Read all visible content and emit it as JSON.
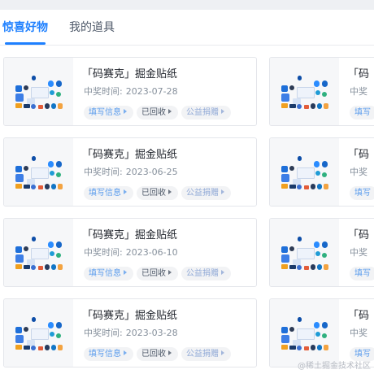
{
  "tabs": [
    {
      "label": "惊喜好物",
      "active": true
    },
    {
      "label": "我的道具",
      "active": false
    }
  ],
  "prize_cards": [
    {
      "title": "「码赛克」掘金贴纸",
      "date_label": "中奖时间:",
      "date": "2023-07-28",
      "actions": [
        "填写信息",
        "已回收",
        "公益捐赠"
      ]
    },
    {
      "title": "「码赛克」掘金贴纸",
      "date_label": "中奖时间:",
      "date": "2023-06-25",
      "actions": [
        "填写信息",
        "已回收",
        "公益捐赠"
      ]
    },
    {
      "title": "「码赛克」掘金贴纸",
      "date_label": "中奖时间:",
      "date": "2023-06-10",
      "actions": [
        "填写信息",
        "已回收",
        "公益捐赠"
      ]
    },
    {
      "title": "「码赛克」掘金贴纸",
      "date_label": "中奖时间:",
      "date": "2023-03-28",
      "actions": [
        "填写信息",
        "已回收",
        "公益捐赠"
      ]
    }
  ],
  "right_cards": [
    {
      "title": "「码",
      "date_label": "中奖",
      "action": "填写"
    },
    {
      "title": "「码",
      "date_label": "中奖",
      "action": "填写"
    },
    {
      "title": "「码",
      "date_label": "中奖",
      "action": "填写"
    },
    {
      "title": "「码",
      "date_label": "中奖",
      "action": "填写"
    }
  ],
  "watermark": "@稀土掘金技术社区",
  "colors": {
    "accent": "#1e80ff",
    "pill_bg": "#f2f3f5",
    "page_strip": "#eef0f3"
  },
  "icons": {
    "pill_arrow": "caret-right-icon",
    "thumbnail": "sticker-sheet-image"
  }
}
